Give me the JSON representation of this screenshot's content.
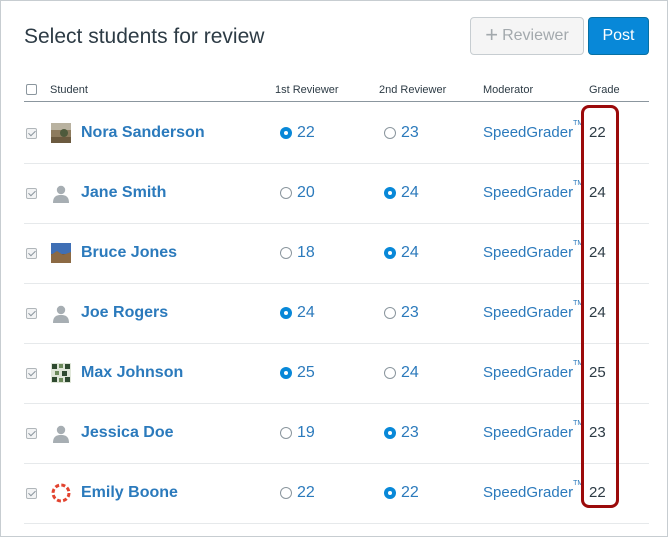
{
  "header": {
    "title": "Select students for review",
    "reviewer_button": "Reviewer",
    "post_button": "Post"
  },
  "columns": {
    "student": "Student",
    "first_reviewer": "1st Reviewer",
    "second_reviewer": "2nd Reviewer",
    "moderator": "Moderator",
    "grade": "Grade"
  },
  "moderator_link": "SpeedGrader",
  "trademark": "TM",
  "students": [
    {
      "name": "Nora Sanderson",
      "avatar": "photo-avatar-landscape",
      "checked": true,
      "first": "22",
      "second": "23",
      "selected": "first",
      "grade": "22"
    },
    {
      "name": "Jane Smith",
      "avatar": "default-person-icon",
      "checked": true,
      "first": "20",
      "second": "24",
      "selected": "second",
      "grade": "24"
    },
    {
      "name": "Bruce Jones",
      "avatar": "photo-avatar-sky",
      "checked": true,
      "first": "18",
      "second": "24",
      "selected": "second",
      "grade": "24"
    },
    {
      "name": "Joe Rogers",
      "avatar": "default-person-icon",
      "checked": true,
      "first": "24",
      "second": "23",
      "selected": "first",
      "grade": "24"
    },
    {
      "name": "Max Johnson",
      "avatar": "photo-avatar-pattern",
      "checked": true,
      "first": "25",
      "second": "24",
      "selected": "first",
      "grade": "25"
    },
    {
      "name": "Jessica Doe",
      "avatar": "default-person-icon",
      "checked": true,
      "first": "19",
      "second": "23",
      "selected": "second",
      "grade": "23"
    },
    {
      "name": "Emily Boone",
      "avatar": "lifebuoy-avatar",
      "checked": true,
      "first": "22",
      "second": "22",
      "selected": "second",
      "grade": "22"
    }
  ],
  "colors": {
    "link": "#2b7abc",
    "primary_button": "#0888d8",
    "highlight_box": "#9b0a0a"
  }
}
